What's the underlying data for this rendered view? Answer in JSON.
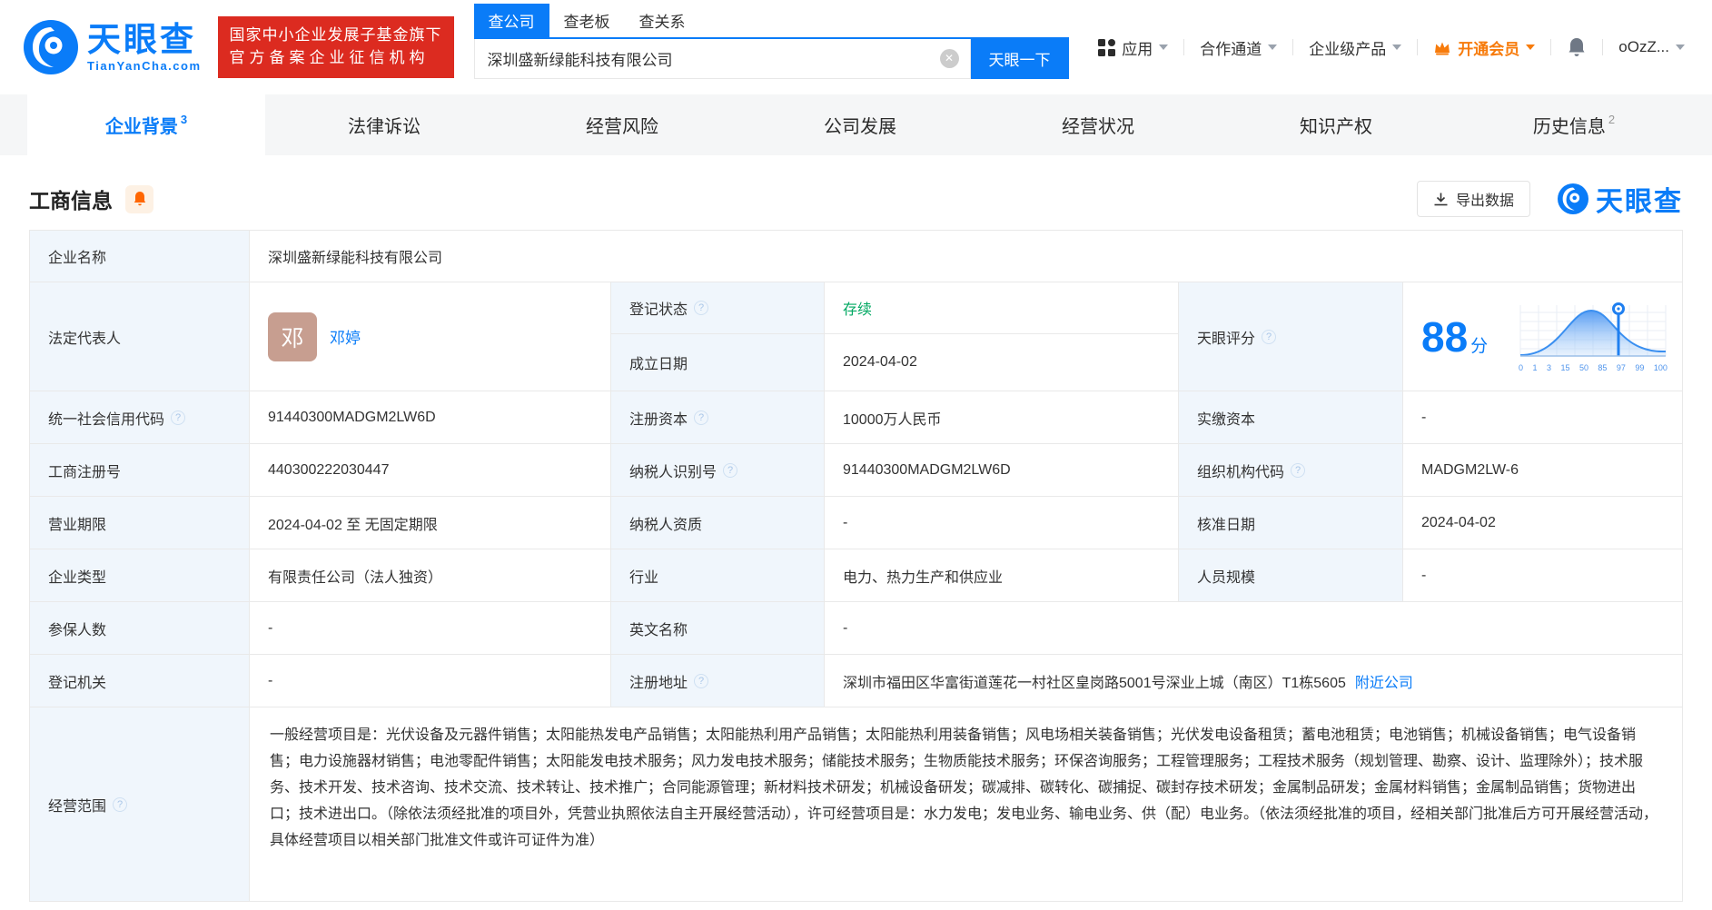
{
  "brand": {
    "name": "天眼查",
    "domain": "TianYanCha.com",
    "badge_line1": "国家中小企业发展子基金旗下",
    "badge_line2": "官方备案企业征信机构",
    "watermark": "天眼查"
  },
  "search": {
    "tabs": [
      "查公司",
      "查老板",
      "查关系"
    ],
    "value": "深圳盛新绿能科技有限公司",
    "button": "天眼一下"
  },
  "nav": {
    "apps": "应用",
    "coop": "合作通道",
    "enterprise": "企业级产品",
    "vip": "开通会员",
    "user": "oOzZ..."
  },
  "tabs": [
    {
      "label": "企业背景",
      "badge": "3"
    },
    {
      "label": "法律诉讼",
      "badge": ""
    },
    {
      "label": "经营风险",
      "badge": ""
    },
    {
      "label": "公司发展",
      "badge": ""
    },
    {
      "label": "经营状况",
      "badge": ""
    },
    {
      "label": "知识产权",
      "badge": ""
    },
    {
      "label": "历史信息",
      "badge": "2"
    }
  ],
  "section": {
    "title": "工商信息",
    "export": "导出数据"
  },
  "company": {
    "name_label": "企业名称",
    "name": "深圳盛新绿能科技有限公司",
    "legal_rep_label": "法定代表人",
    "legal_rep_avatar": "邓",
    "legal_rep": "邓婷",
    "reg_status_label": "登记状态",
    "reg_status": "存续",
    "establish_label": "成立日期",
    "establish": "2024-04-02",
    "score_label": "天眼评分",
    "score": "88",
    "score_unit": "分",
    "credit_code_label": "统一社会信用代码",
    "credit_code": "91440300MADGM2LW6D",
    "reg_capital_label": "注册资本",
    "reg_capital": "10000万人民币",
    "paid_capital_label": "实缴资本",
    "paid_capital": "-",
    "reg_no_label": "工商注册号",
    "reg_no": "440300222030447",
    "taxpayer_id_label": "纳税人识别号",
    "taxpayer_id": "91440300MADGM2LW6D",
    "org_code_label": "组织机构代码",
    "org_code": "MADGM2LW-6",
    "term_label": "营业期限",
    "term": "2024-04-02 至 无固定期限",
    "taxpayer_qual_label": "纳税人资质",
    "taxpayer_qual": "-",
    "approve_date_label": "核准日期",
    "approve_date": "2024-04-02",
    "type_label": "企业类型",
    "type": "有限责任公司（法人独资）",
    "industry_label": "行业",
    "industry": "电力、热力生产和供应业",
    "staff_label": "人员规模",
    "staff": "-",
    "insured_label": "参保人数",
    "insured": "-",
    "en_name_label": "英文名称",
    "en_name": "-",
    "reg_authority_label": "登记机关",
    "reg_authority": "-",
    "address_label": "注册地址",
    "address": "深圳市福田区华富街道莲花一村社区皇岗路5001号深业上城（南区）T1栋5605",
    "nearby_link": "附近公司",
    "scope_label": "经营范围",
    "scope": "一般经营项目是：光伏设备及元器件销售；太阳能热发电产品销售；太阳能热利用产品销售；太阳能热利用装备销售；风电场相关装备销售；光伏发电设备租赁；蓄电池租赁；电池销售；机械设备销售；电气设备销售；电力设施器材销售；电池零配件销售；太阳能发电技术服务；风力发电技术服务；储能技术服务；生物质能技术服务；环保咨询服务；工程管理服务；工程技术服务（规划管理、勘察、设计、监理除外）；技术服务、技术开发、技术咨询、技术交流、技术转让、技术推广；合同能源管理；新材料技术研发；机械设备研发；碳减排、碳转化、碳捕捉、碳封存技术研发；金属制品研发；金属材料销售；金属制品销售；货物进出口；技术进出口。（除依法须经批准的项目外，凭营业执照依法自主开展经营活动），许可经营项目是：水力发电；发电业务、输电业务、供（配）电业务。（依法须经批准的项目，经相关部门批准后方可开展经营活动，具体经营项目以相关部门批准文件或许可证件为准）"
  },
  "score_chart": {
    "type": "area",
    "axis_labels": [
      "0",
      "1",
      "3",
      "15",
      "50",
      "85",
      "97",
      "99",
      "100"
    ],
    "marker_value": "88"
  },
  "colors": {
    "brand_blue": "#0a7cf8",
    "badge_red": "#dc2b20",
    "vip_orange": "#f77b0b",
    "status_green": "#00a862"
  }
}
